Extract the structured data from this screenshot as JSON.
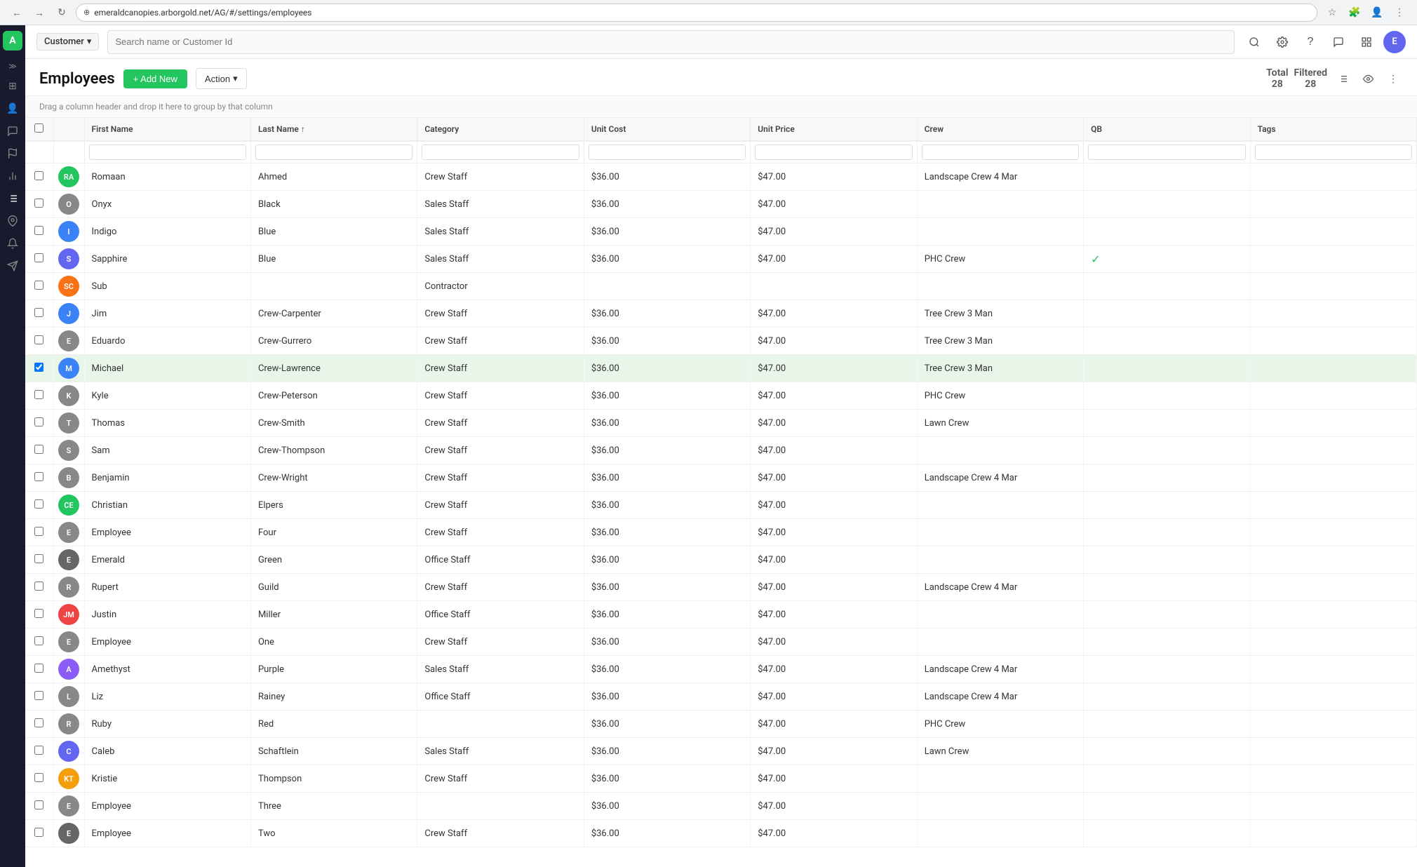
{
  "browser": {
    "url": "emeraldcanopies.arborgold.net/AG/#/settings/employees",
    "back_icon": "←",
    "forward_icon": "→",
    "refresh_icon": "↻"
  },
  "top_nav": {
    "customer_label": "Customer",
    "search_placeholder": "Search name or Customer Id",
    "avatar_initials": "E"
  },
  "sidebar": {
    "logo_text": "A",
    "items": [
      {
        "name": "expand",
        "icon": "≫"
      },
      {
        "name": "grid",
        "icon": "⊞"
      },
      {
        "name": "person",
        "icon": "👤"
      },
      {
        "name": "chat",
        "icon": "💬"
      },
      {
        "name": "chart",
        "icon": "📊"
      },
      {
        "name": "list",
        "icon": "☰"
      },
      {
        "name": "location",
        "icon": "📍"
      },
      {
        "name": "bell",
        "icon": "🔔"
      },
      {
        "name": "send",
        "icon": "➤"
      }
    ]
  },
  "page": {
    "title": "Employees",
    "add_new_label": "+ Add New",
    "action_label": "Action",
    "total_label": "Total",
    "total_count": "28",
    "filtered_label": "Filtered",
    "filtered_count": "28",
    "drag_hint": "Drag a column header and drop it here to group by that column"
  },
  "table": {
    "columns": [
      {
        "key": "check",
        "label": ""
      },
      {
        "key": "avatar",
        "label": ""
      },
      {
        "key": "firstName",
        "label": "First Name"
      },
      {
        "key": "lastName",
        "label": "Last Name ↑"
      },
      {
        "key": "category",
        "label": "Category"
      },
      {
        "key": "unitCost",
        "label": "Unit Cost"
      },
      {
        "key": "unitPrice",
        "label": "Unit Price"
      },
      {
        "key": "crew",
        "label": "Crew"
      },
      {
        "key": "qb",
        "label": "QB"
      },
      {
        "key": "tags",
        "label": "Tags"
      }
    ],
    "rows": [
      {
        "id": 1,
        "initials": "RA",
        "avatarColor": "#22c55e",
        "firstName": "Romaan",
        "lastName": "Ahmed",
        "category": "Crew Staff",
        "unitCost": "$36.00",
        "unitPrice": "$47.00",
        "crew": "Landscape Crew 4 Mar",
        "qb": "",
        "tags": "",
        "selected": false
      },
      {
        "id": 2,
        "initials": "O",
        "avatarColor": "#888",
        "firstName": "Onyx",
        "lastName": "Black",
        "category": "Sales Staff",
        "unitCost": "$36.00",
        "unitPrice": "$47.00",
        "crew": "",
        "qb": "",
        "tags": "",
        "selected": false
      },
      {
        "id": 3,
        "initials": "I",
        "avatarColor": "#3b82f6",
        "firstName": "Indigo",
        "lastName": "Blue",
        "category": "Sales Staff",
        "unitCost": "$36.00",
        "unitPrice": "$47.00",
        "crew": "",
        "qb": "",
        "tags": "",
        "selected": false
      },
      {
        "id": 4,
        "initials": "S",
        "avatarColor": "#6366f1",
        "firstName": "Sapphire",
        "lastName": "Blue",
        "category": "Sales Staff",
        "unitCost": "$36.00",
        "unitPrice": "$47.00",
        "crew": "PHC Crew",
        "qb": "✓",
        "tags": "",
        "selected": false
      },
      {
        "id": 5,
        "initials": "SC",
        "avatarColor": "#f97316",
        "firstName": "Sub",
        "lastName": "",
        "category": "Contractor",
        "unitCost": "",
        "unitPrice": "",
        "crew": "",
        "qb": "",
        "tags": "",
        "selected": false
      },
      {
        "id": 6,
        "initials": "J",
        "avatarColor": "#3b82f6",
        "firstName": "Jim",
        "lastName": "Crew-Carpenter",
        "category": "Crew Staff",
        "unitCost": "$36.00",
        "unitPrice": "$47.00",
        "crew": "Tree Crew 3 Man",
        "qb": "",
        "tags": "",
        "selected": false
      },
      {
        "id": 7,
        "initials": "E",
        "avatarColor": "#888",
        "firstName": "Eduardo",
        "lastName": "Crew-Gurrero",
        "category": "Crew Staff",
        "unitCost": "$36.00",
        "unitPrice": "$47.00",
        "crew": "Tree Crew 3 Man",
        "qb": "",
        "tags": "",
        "selected": false
      },
      {
        "id": 8,
        "initials": "M",
        "avatarColor": "#3b82f6",
        "firstName": "Michael",
        "lastName": "Crew-Lawrence",
        "category": "Crew Staff",
        "unitCost": "$36.00",
        "unitPrice": "$47.00",
        "crew": "Tree Crew 3 Man",
        "qb": "",
        "tags": "",
        "selected": true
      },
      {
        "id": 9,
        "initials": "K",
        "avatarColor": "#888",
        "firstName": "Kyle",
        "lastName": "Crew-Peterson",
        "category": "Crew Staff",
        "unitCost": "$36.00",
        "unitPrice": "$47.00",
        "crew": "PHC Crew",
        "qb": "",
        "tags": "",
        "selected": false
      },
      {
        "id": 10,
        "initials": "T",
        "avatarColor": "#888",
        "firstName": "Thomas",
        "lastName": "Crew-Smith",
        "category": "Crew Staff",
        "unitCost": "$36.00",
        "unitPrice": "$47.00",
        "crew": "Lawn Crew",
        "qb": "",
        "tags": "",
        "selected": false
      },
      {
        "id": 11,
        "initials": "S",
        "avatarColor": "#888",
        "firstName": "Sam",
        "lastName": "Crew-Thompson",
        "category": "Crew Staff",
        "unitCost": "$36.00",
        "unitPrice": "$47.00",
        "crew": "",
        "qb": "",
        "tags": "",
        "selected": false
      },
      {
        "id": 12,
        "initials": "B",
        "avatarColor": "#888",
        "firstName": "Benjamin",
        "lastName": "Crew-Wright",
        "category": "Crew Staff",
        "unitCost": "$36.00",
        "unitPrice": "$47.00",
        "crew": "Landscape Crew 4 Mar",
        "qb": "",
        "tags": "",
        "selected": false
      },
      {
        "id": 13,
        "initials": "CE",
        "avatarColor": "#22c55e",
        "firstName": "Christian",
        "lastName": "Elpers",
        "category": "Crew Staff",
        "unitCost": "$36.00",
        "unitPrice": "$47.00",
        "crew": "",
        "qb": "",
        "tags": "",
        "selected": false
      },
      {
        "id": 14,
        "initials": "E",
        "avatarColor": "#888",
        "firstName": "Employee",
        "lastName": "Four",
        "category": "Crew Staff",
        "unitCost": "$36.00",
        "unitPrice": "$47.00",
        "crew": "",
        "qb": "",
        "tags": "",
        "selected": false
      },
      {
        "id": 15,
        "initials": "E",
        "avatarColor": "#666",
        "firstName": "Emerald",
        "lastName": "Green",
        "category": "Office Staff",
        "unitCost": "$36.00",
        "unitPrice": "$47.00",
        "crew": "",
        "qb": "",
        "tags": "",
        "selected": false
      },
      {
        "id": 16,
        "initials": "R",
        "avatarColor": "#888",
        "firstName": "Rupert",
        "lastName": "Guild",
        "category": "Crew Staff",
        "unitCost": "$36.00",
        "unitPrice": "$47.00",
        "crew": "Landscape Crew 4 Mar",
        "qb": "",
        "tags": "",
        "selected": false
      },
      {
        "id": 17,
        "initials": "JM",
        "avatarColor": "#ef4444",
        "firstName": "Justin",
        "lastName": "Miller",
        "category": "Office Staff",
        "unitCost": "$36.00",
        "unitPrice": "$47.00",
        "crew": "",
        "qb": "",
        "tags": "",
        "selected": false
      },
      {
        "id": 18,
        "initials": "E",
        "avatarColor": "#888",
        "firstName": "Employee",
        "lastName": "One",
        "category": "Crew Staff",
        "unitCost": "$36.00",
        "unitPrice": "$47.00",
        "crew": "",
        "qb": "",
        "tags": "",
        "selected": false
      },
      {
        "id": 19,
        "initials": "A",
        "avatarColor": "#8b5cf6",
        "firstName": "Amethyst",
        "lastName": "Purple",
        "category": "Sales Staff",
        "unitCost": "$36.00",
        "unitPrice": "$47.00",
        "crew": "Landscape Crew 4 Mar",
        "qb": "",
        "tags": "",
        "selected": false
      },
      {
        "id": 20,
        "initials": "L",
        "avatarColor": "#888",
        "firstName": "Liz",
        "lastName": "Rainey",
        "category": "Office Staff",
        "unitCost": "$36.00",
        "unitPrice": "$47.00",
        "crew": "Landscape Crew 4 Mar",
        "qb": "",
        "tags": "",
        "selected": false
      },
      {
        "id": 21,
        "initials": "R",
        "avatarColor": "#888",
        "firstName": "Ruby",
        "lastName": "Red",
        "category": "",
        "unitCost": "$36.00",
        "unitPrice": "$47.00",
        "crew": "PHC Crew",
        "qb": "",
        "tags": "",
        "selected": false
      },
      {
        "id": 22,
        "initials": "C",
        "avatarColor": "#6366f1",
        "firstName": "Caleb",
        "lastName": "Schaftlein",
        "category": "Sales Staff",
        "unitCost": "$36.00",
        "unitPrice": "$47.00",
        "crew": "Lawn Crew",
        "qb": "",
        "tags": "",
        "selected": false
      },
      {
        "id": 23,
        "initials": "KT",
        "avatarColor": "#f59e0b",
        "firstName": "Kristie",
        "lastName": "Thompson",
        "category": "Crew Staff",
        "unitCost": "$36.00",
        "unitPrice": "$47.00",
        "crew": "",
        "qb": "",
        "tags": "",
        "selected": false
      },
      {
        "id": 24,
        "initials": "E",
        "avatarColor": "#888",
        "firstName": "Employee",
        "lastName": "Three",
        "category": "",
        "unitCost": "$36.00",
        "unitPrice": "$47.00",
        "crew": "",
        "qb": "",
        "tags": "",
        "selected": false
      },
      {
        "id": 25,
        "initials": "E",
        "avatarColor": "#666",
        "firstName": "Employee",
        "lastName": "Two",
        "category": "Crew Staff",
        "unitCost": "$36.00",
        "unitPrice": "$47.00",
        "crew": "",
        "qb": "",
        "tags": "",
        "selected": false
      }
    ]
  }
}
